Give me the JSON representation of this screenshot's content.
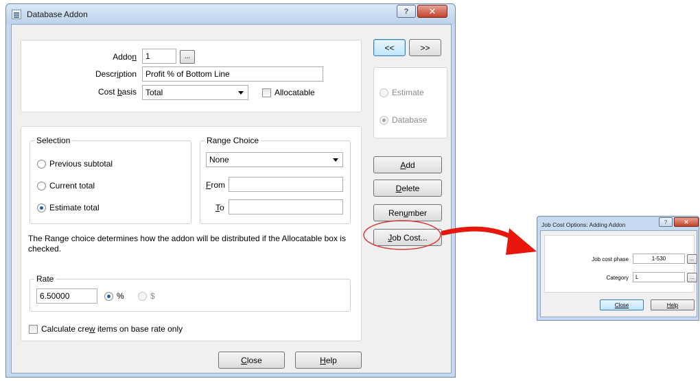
{
  "main_dialog": {
    "title": "Database Addon",
    "help_glyph": "?",
    "close_glyph": "✕"
  },
  "addon_panel": {
    "addon_label_pre": "Addo",
    "addon_label_key": "n",
    "addon_value": "1",
    "browse_label": "...",
    "description_label_pre": "Descr",
    "description_label_key": "i",
    "description_label_post": "ption",
    "description_value": "Profit % of Bottom Line",
    "cost_basis_label_pre": "Cost ",
    "cost_basis_label_key": "b",
    "cost_basis_label_post": "asis",
    "cost_basis_value": "Total",
    "allocatable_label": "Allocatable",
    "allocatable_checked": false
  },
  "nav": {
    "prev_label": "<<",
    "next_label": ">>"
  },
  "mode": {
    "estimate_label": "Estimate",
    "database_label": "Database",
    "selected": "Database"
  },
  "selection": {
    "legend": "Selection",
    "options": [
      "Previous subtotal",
      "Current total",
      "Estimate total"
    ],
    "selected": "Estimate total"
  },
  "range_choice": {
    "legend": "Range Choice",
    "value": "None",
    "from_key": "F",
    "from_rest": "rom",
    "from_value": "",
    "to_key": "T",
    "to_rest": "o",
    "to_value": ""
  },
  "range_note": "The Range choice determines how the addon will be distributed if the Allocatable box is checked.",
  "rate": {
    "legend": "Rate",
    "value": "6.50000",
    "percent_label": "%",
    "dollar_label": "$",
    "selected": "%"
  },
  "crew": {
    "label_pre": "Calculate cre",
    "label_key": "w",
    "label_post": " items on base rate only",
    "checked": false
  },
  "side_buttons": {
    "add_key": "A",
    "add_rest": "dd",
    "delete_key": "D",
    "delete_rest": "elete",
    "renumber_pre": "Ren",
    "renumber_key": "u",
    "renumber_post": "mber",
    "jobcost_key": "J",
    "jobcost_rest": "ob Cost..."
  },
  "bottom_buttons": {
    "close_key": "C",
    "close_rest": "lose",
    "help_key": "H",
    "help_rest": "elp"
  },
  "job_cost_dialog": {
    "title": "Job Cost Options:  Adding Addon",
    "help_glyph": "?",
    "close_glyph": "✕",
    "phase_label": "Job cost phase",
    "phase_value": "1-530",
    "category_label": "Category",
    "category_value": "L",
    "browse_label": "...",
    "close_label": "Close",
    "help_label": "Help"
  },
  "colors": {
    "arrow": "#e8170e",
    "highlight_ellipse": "#d53a3a"
  }
}
